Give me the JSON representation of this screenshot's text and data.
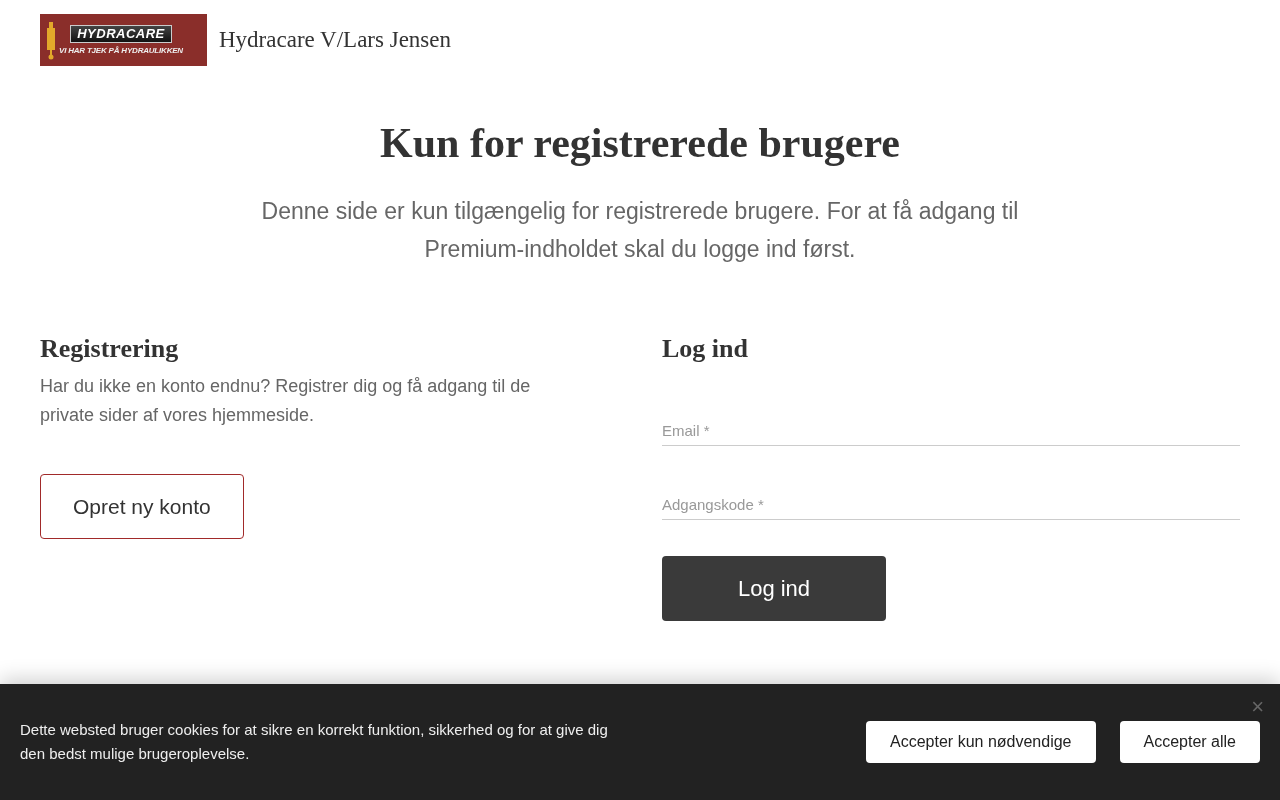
{
  "header": {
    "logo": {
      "wordmark_part_1": "HYDRA",
      "wordmark_part_2": "CARE",
      "tagline": "VI HAR TJEK PÅ HYDRAULIKKEN"
    },
    "site_name": "Hydracare V/Lars Jensen"
  },
  "title": "Kun for registrerede brugere",
  "intro": "Denne side er kun tilgængelig for registrerede brugere. For at få adgang til Premium-indholdet skal du logge ind først.",
  "registration": {
    "heading": "Registrering",
    "text": "Har du ikke en konto endnu? Registrer dig og få adgang til de private sider af vores hjemmeside.",
    "button": "Opret ny konto"
  },
  "login": {
    "heading": "Log ind",
    "fields": [
      {
        "label": "Email",
        "required_mark": "*"
      },
      {
        "label": "Adgangskode",
        "required_mark": "*"
      }
    ],
    "button": "Log ind"
  },
  "cookie_banner": {
    "text": "Dette websted bruger cookies for at sikre en korrekt funktion, sikkerhed og for at give dig den bedst mulige brugeroplevelse.",
    "buttons": [
      "Accepter kun nødvendige",
      "Accepter alle"
    ],
    "close": "×"
  }
}
